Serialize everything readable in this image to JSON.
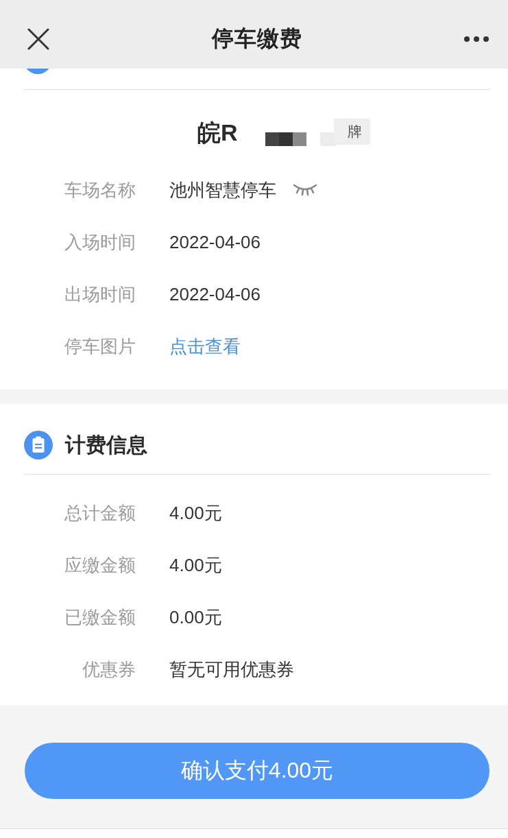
{
  "nav": {
    "title": "停车缴费"
  },
  "parking_info": {
    "plate": {
      "prefix": "皖R",
      "tag": "牌"
    },
    "rows": [
      {
        "label": "车场名称",
        "value": "池州智慧停车",
        "kind": "eye"
      },
      {
        "label": "入场时间",
        "value": "2022-04-06",
        "kind": "text"
      },
      {
        "label": "出场时间",
        "value": "2022-04-06",
        "kind": "text"
      },
      {
        "label": "停车图片",
        "value": "点击查看",
        "kind": "link"
      }
    ]
  },
  "billing": {
    "title": "计费信息",
    "rows": [
      {
        "label": "总计金额",
        "value": "4.00元",
        "kind": "text"
      },
      {
        "label": "应缴金额",
        "value": "4.00元",
        "kind": "text"
      },
      {
        "label": "已缴金额",
        "value": "0.00元",
        "kind": "text"
      },
      {
        "label": "优惠券",
        "value": "暂无可用优惠券",
        "kind": "text"
      }
    ]
  },
  "pay_button": {
    "label": "确认支付4.00元"
  }
}
